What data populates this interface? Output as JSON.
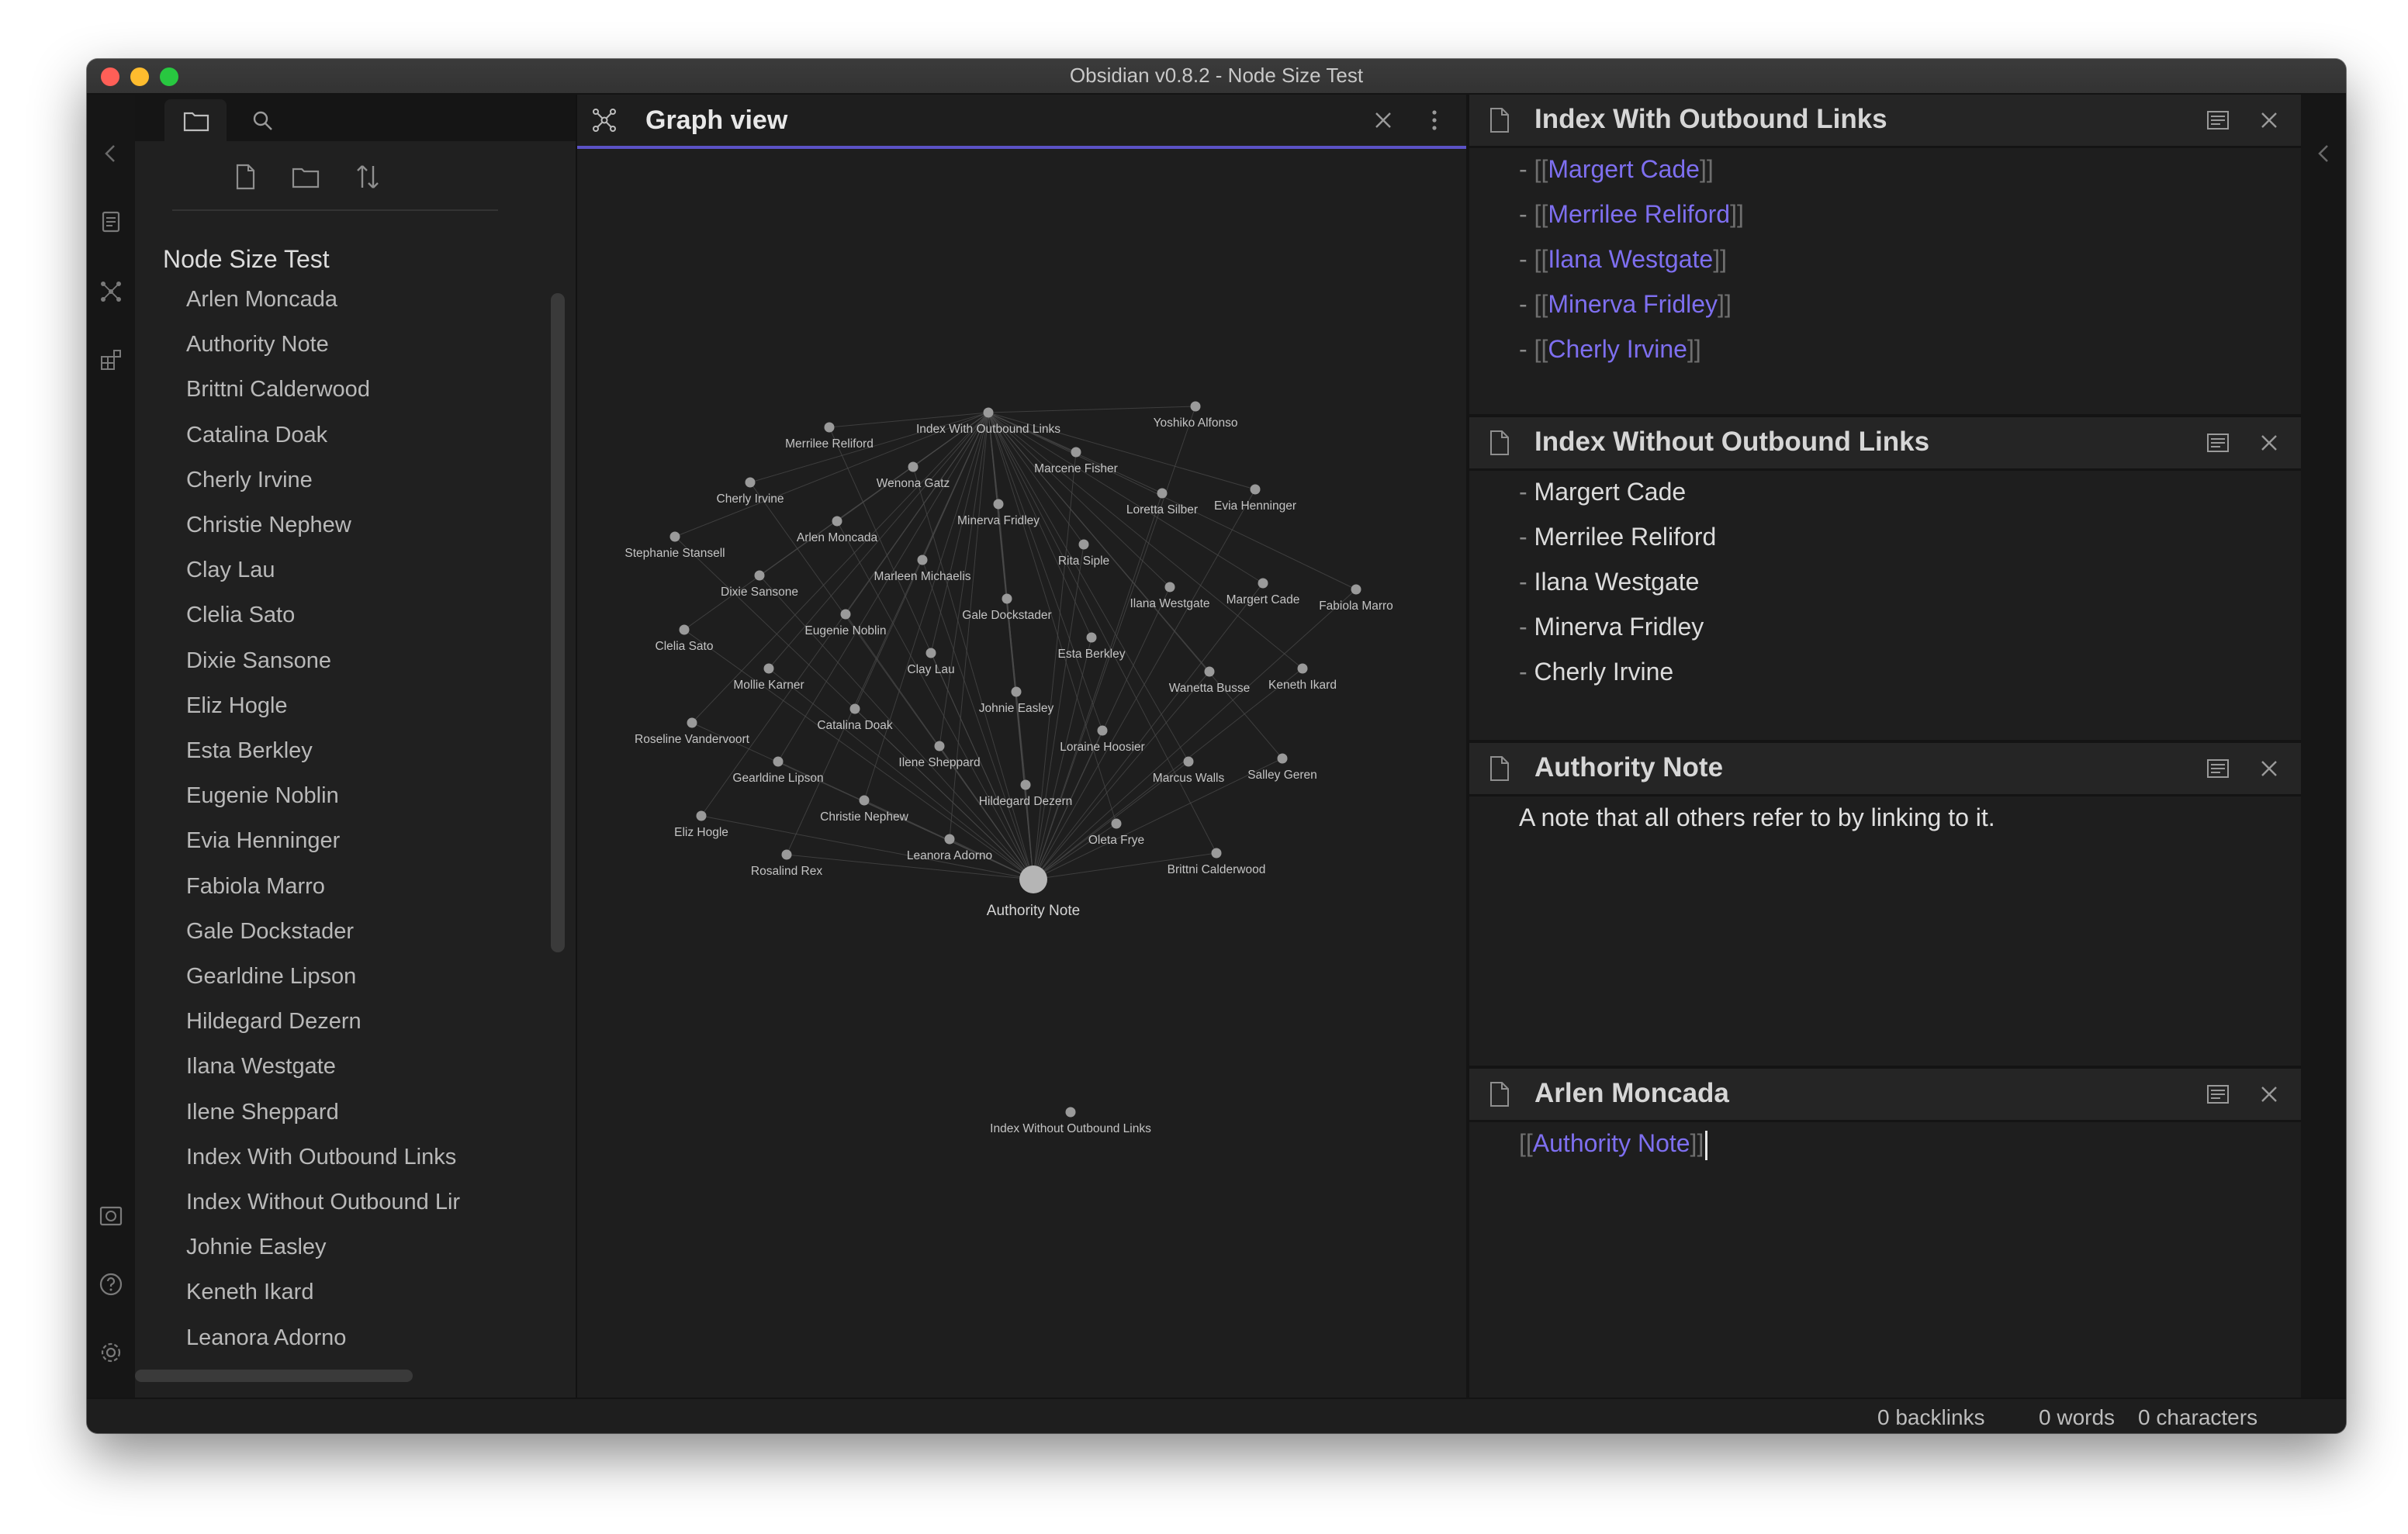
{
  "window": {
    "title": "Obsidian v0.8.2 - Node Size Test"
  },
  "colors": {
    "accent": "#7e6ff0",
    "background": "#1e1e1e",
    "graph_node": "#9a9a9a",
    "graph_edge": "#4a4a4a"
  },
  "icons": {
    "ribbon_top": [
      "collapse-left-icon"
    ],
    "ribbon": [
      "open-quick-switcher-icon",
      "graph-view-icon",
      "plugins-icon"
    ],
    "ribbon_bottom": [
      "open-vault-icon",
      "help-icon",
      "settings-icon"
    ],
    "left_tabs": [
      "folder-icon",
      "search-icon"
    ],
    "file_actions": [
      "new-note-icon",
      "new-folder-icon",
      "sort-icon"
    ]
  },
  "file_explorer": {
    "vault_name": "Node Size Test",
    "files": [
      "Arlen Moncada",
      "Authority Note",
      "Brittni Calderwood",
      "Catalina Doak",
      "Cherly Irvine",
      "Christie Nephew",
      "Clay Lau",
      "Clelia Sato",
      "Dixie Sansone",
      "Eliz Hogle",
      "Esta Berkley",
      "Eugenie Noblin",
      "Evia Henninger",
      "Fabiola Marro",
      "Gale Dockstader",
      "Gearldine Lipson",
      "Hildegard Dezern",
      "Ilana Westgate",
      "Ilene Sheppard",
      "Index With Outbound Links",
      "Index Without Outbound Lir",
      "Johnie Easley",
      "Keneth Ikard",
      "Leanora Adorno"
    ]
  },
  "graph_view": {
    "title": "Graph view",
    "hub": "Authority Note",
    "index": "Index With Outbound Links",
    "nodes": [
      {
        "label": "Index With Outbound Links"
      },
      {
        "label": "Yoshiko Alfonso"
      },
      {
        "label": "Merrilee Reliford"
      },
      {
        "label": "Marcene Fisher"
      },
      {
        "label": "Wenona Gatz"
      },
      {
        "label": "Cherly Irvine"
      },
      {
        "label": "Loretta Silber"
      },
      {
        "label": "Evia Henninger"
      },
      {
        "label": "Minerva Fridley"
      },
      {
        "label": "Arlen Moncada"
      },
      {
        "label": "Stephanie Stansell"
      },
      {
        "label": "Rita Siple"
      },
      {
        "label": "Marleen Michaelis"
      },
      {
        "label": "Dixie Sansone"
      },
      {
        "label": "Margert Cade"
      },
      {
        "label": "Ilana Westgate"
      },
      {
        "label": "Fabiola Marro"
      },
      {
        "label": "Gale Dockstader"
      },
      {
        "label": "Eugenie Noblin"
      },
      {
        "label": "Clelia Sato"
      },
      {
        "label": "Esta Berkley"
      },
      {
        "label": "Clay Lau"
      },
      {
        "label": "Mollie Karner"
      },
      {
        "label": "Wanetta Busse"
      },
      {
        "label": "Keneth Ikard"
      },
      {
        "label": "Johnie Easley"
      },
      {
        "label": "Catalina Doak"
      },
      {
        "label": "Roseline Vandervoort"
      },
      {
        "label": "Loraine Hoosier"
      },
      {
        "label": "Ilene Sheppard"
      },
      {
        "label": "Gearldine Lipson"
      },
      {
        "label": "Marcus Walls"
      },
      {
        "label": "Salley Geren"
      },
      {
        "label": "Hildegard Dezern"
      },
      {
        "label": "Christie Nephew"
      },
      {
        "label": "Eliz Hogle"
      },
      {
        "label": "Oleta Frye"
      },
      {
        "label": "Leanora Adorno"
      },
      {
        "label": "Rosalind Rex"
      },
      {
        "label": "Brittni Calderwood"
      },
      {
        "label": "Authority Note"
      },
      {
        "label": "Index Without Outbound Links"
      }
    ]
  },
  "notes": [
    {
      "title": "Index With Outbound Links",
      "lines": [
        "Margert Cade",
        "Merrilee Reliford",
        "Ilana Westgate",
        "Minerva Fridley",
        "Cherly Irvine"
      ]
    },
    {
      "title": "Index Without Outbound Links",
      "lines": [
        "Margert Cade",
        "Merrilee Reliford",
        "Ilana Westgate",
        "Minerva Fridley",
        "Cherly Irvine"
      ]
    },
    {
      "title": "Authority Note",
      "body": "A note that all others refer to by linking to it."
    },
    {
      "title": "Arlen Moncada",
      "link": "Authority Note"
    }
  ],
  "syntax": {
    "dash": "- ",
    "open": "[[",
    "close": "]]"
  },
  "status": {
    "backlinks": "0 backlinks",
    "words": "0 words",
    "characters": "0 characters"
  }
}
